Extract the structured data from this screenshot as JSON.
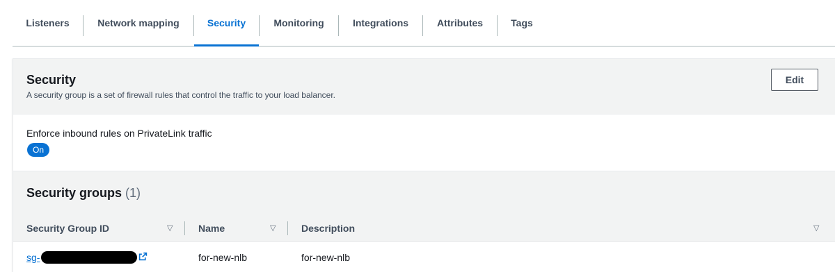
{
  "tabs": [
    {
      "label": "Listeners",
      "active": false
    },
    {
      "label": "Network mapping",
      "active": false
    },
    {
      "label": "Security",
      "active": true
    },
    {
      "label": "Monitoring",
      "active": false
    },
    {
      "label": "Integrations",
      "active": false
    },
    {
      "label": "Attributes",
      "active": false
    },
    {
      "label": "Tags",
      "active": false
    }
  ],
  "security": {
    "title": "Security",
    "description": "A security group is a set of firewall rules that control the traffic to your load balancer.",
    "edit_label": "Edit"
  },
  "enforce": {
    "label": "Enforce inbound rules on PrivateLink traffic",
    "status": "On"
  },
  "groups": {
    "title": "Security groups",
    "count": "(1)",
    "columns": [
      "Security Group ID",
      "Name",
      "Description"
    ],
    "rows": [
      {
        "id_prefix": "sg-",
        "name": "for-new-nlb",
        "description": "for-new-nlb"
      }
    ]
  },
  "icons": {
    "sort": "caret-down-outline-icon",
    "external": "external-link-icon"
  },
  "colors": {
    "accent": "#0972d3",
    "header_bg": "#f2f3f3",
    "text": "#16191f"
  }
}
